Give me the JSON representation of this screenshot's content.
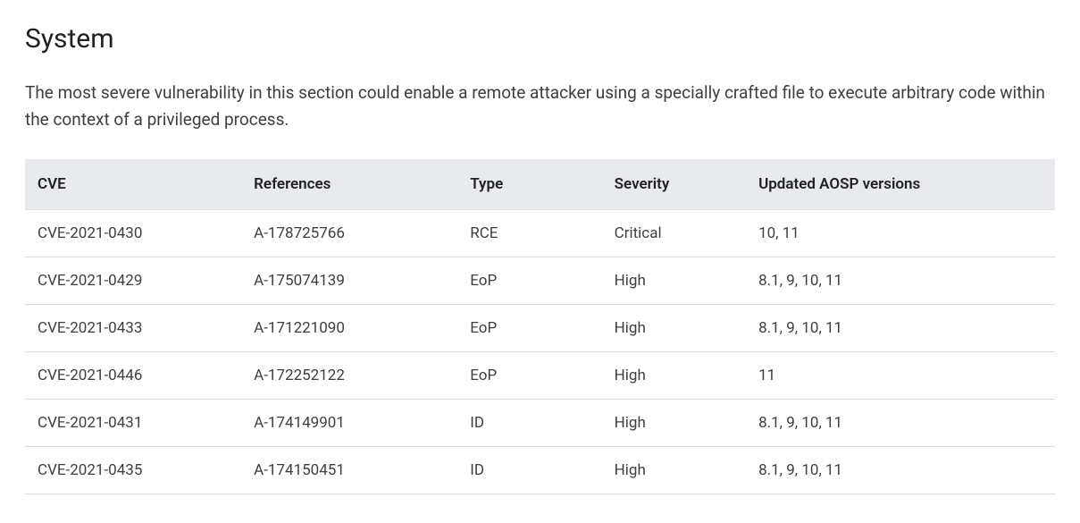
{
  "section": {
    "title": "System",
    "description": "The most severe vulnerability in this section could enable a remote attacker using a specially crafted file to execute arbitrary code within the context of a privileged process."
  },
  "table": {
    "headers": {
      "cve": "CVE",
      "references": "References",
      "type": "Type",
      "severity": "Severity",
      "aosp": "Updated AOSP versions"
    },
    "rows": [
      {
        "cve": "CVE-2021-0430",
        "references": "A-178725766",
        "type": "RCE",
        "severity": "Critical",
        "aosp": "10, 11"
      },
      {
        "cve": "CVE-2021-0429",
        "references": "A-175074139",
        "type": "EoP",
        "severity": "High",
        "aosp": "8.1, 9, 10, 11"
      },
      {
        "cve": "CVE-2021-0433",
        "references": "A-171221090",
        "type": "EoP",
        "severity": "High",
        "aosp": "8.1, 9, 10, 11"
      },
      {
        "cve": "CVE-2021-0446",
        "references": "A-172252122",
        "type": "EoP",
        "severity": "High",
        "aosp": "11"
      },
      {
        "cve": "CVE-2021-0431",
        "references": "A-174149901",
        "type": "ID",
        "severity": "High",
        "aosp": "8.1, 9, 10, 11"
      },
      {
        "cve": "CVE-2021-0435",
        "references": "A-174150451",
        "type": "ID",
        "severity": "High",
        "aosp": "8.1, 9, 10, 11"
      }
    ]
  }
}
